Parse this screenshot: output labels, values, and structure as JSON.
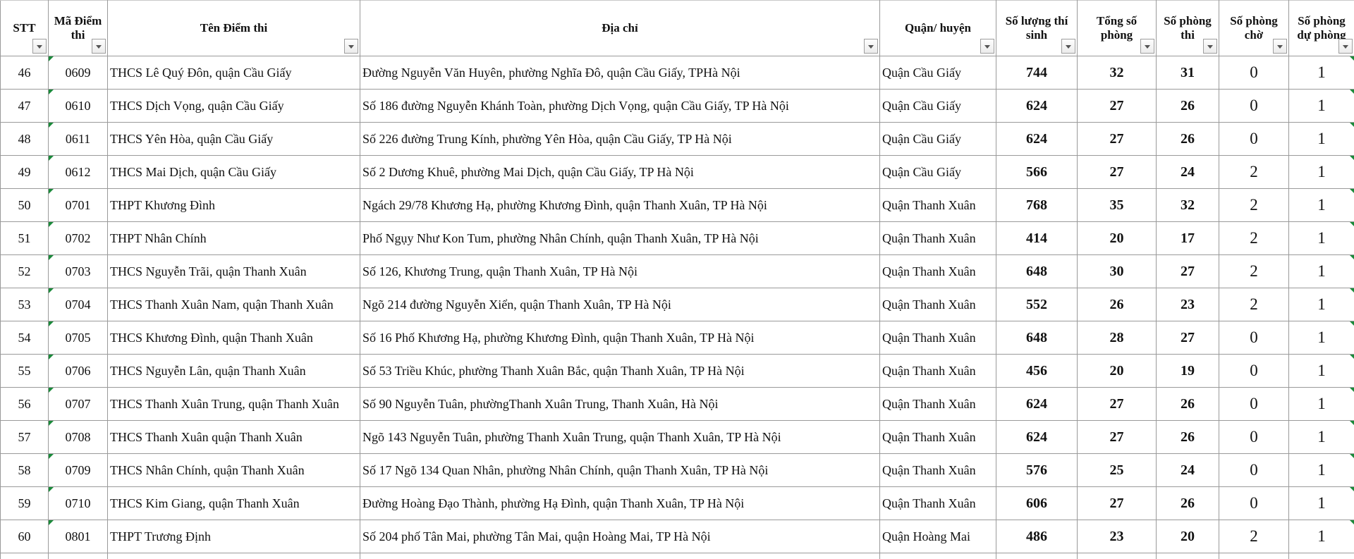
{
  "headers": {
    "stt": "STT",
    "ma_diem_thi": "Mã Điểm thi",
    "ten_diem_thi": "Tên Điểm thi",
    "dia_chi": "Địa chỉ",
    "quan_huyen": "Quận/ huyện",
    "so_luong_thi_sinh": "Số lượng thí sinh",
    "tong_so_phong": "Tổng số phòng",
    "so_phong_thi": "Số phòng thi",
    "so_phong_cho": "Số phòng chờ",
    "so_phong_du_phong": "Số phòng dự phòng"
  },
  "rows": [
    {
      "stt": "46",
      "ma": "0609",
      "ten": "THCS Lê Quý Đôn, quận Cầu Giấy",
      "dia_chi": "Đường Nguyễn Văn Huyên, phường Nghĩa Đô, quận Cầu Giấy, TPHà Nội",
      "quan": "Quận Cầu Giấy",
      "so_luong": "744",
      "tong_phong": "32",
      "phong_thi": "31",
      "phong_cho": "0",
      "du_phong": "1"
    },
    {
      "stt": "47",
      "ma": "0610",
      "ten": "THCS Dịch Vọng, quận Cầu Giấy",
      "dia_chi": "Số 186 đường Nguyễn Khánh Toàn, phường Dịch Vọng, quận Cầu Giấy, TP Hà Nội",
      "quan": "Quận Cầu Giấy",
      "so_luong": "624",
      "tong_phong": "27",
      "phong_thi": "26",
      "phong_cho": "0",
      "du_phong": "1"
    },
    {
      "stt": "48",
      "ma": "0611",
      "ten": "THCS Yên Hòa, quận Cầu Giấy",
      "dia_chi": "Số 226 đường Trung Kính, phường Yên Hòa, quận Cầu Giấy, TP Hà Nội",
      "quan": "Quận Cầu Giấy",
      "so_luong": "624",
      "tong_phong": "27",
      "phong_thi": "26",
      "phong_cho": "0",
      "du_phong": "1"
    },
    {
      "stt": "49",
      "ma": "0612",
      "ten": "THCS Mai Dịch, quận Cầu Giấy",
      "dia_chi": "Số 2 Dương Khuê, phường Mai Dịch, quận Cầu Giấy, TP Hà Nội",
      "quan": "Quận Cầu Giấy",
      "so_luong": "566",
      "tong_phong": "27",
      "phong_thi": "24",
      "phong_cho": "2",
      "du_phong": "1"
    },
    {
      "stt": "50",
      "ma": "0701",
      "ten": "THPT Khương Đình",
      "dia_chi": "Ngách 29/78 Khương Hạ, phường Khương Đình, quận Thanh Xuân, TP Hà Nội",
      "quan": "Quận Thanh Xuân",
      "so_luong": "768",
      "tong_phong": "35",
      "phong_thi": "32",
      "phong_cho": "2",
      "du_phong": "1"
    },
    {
      "stt": "51",
      "ma": "0702",
      "ten": "THPT Nhân Chính",
      "dia_chi": "Phố Ngụy Như Kon Tum, phường Nhân Chính, quận Thanh Xuân, TP Hà Nội",
      "quan": "Quận Thanh Xuân",
      "so_luong": "414",
      "tong_phong": "20",
      "phong_thi": "17",
      "phong_cho": "2",
      "du_phong": "1"
    },
    {
      "stt": "52",
      "ma": "0703",
      "ten": "THCS Nguyễn Trãi, quận Thanh Xuân",
      "dia_chi": "Số 126, Khương Trung, quận Thanh Xuân, TP Hà Nội",
      "quan": "Quận Thanh Xuân",
      "so_luong": "648",
      "tong_phong": "30",
      "phong_thi": "27",
      "phong_cho": "2",
      "du_phong": "1"
    },
    {
      "stt": "53",
      "ma": "0704",
      "ten": "THCS Thanh Xuân Nam, quận Thanh Xuân",
      "dia_chi": "Ngõ 214 đường Nguyễn Xiển, quận Thanh Xuân, TP Hà Nội",
      "quan": "Quận Thanh Xuân",
      "so_luong": "552",
      "tong_phong": "26",
      "phong_thi": "23",
      "phong_cho": "2",
      "du_phong": "1"
    },
    {
      "stt": "54",
      "ma": "0705",
      "ten": "THCS Khương Đình, quận Thanh Xuân",
      "dia_chi": "Số 16 Phố Khương Hạ, phường Khương Đình, quận Thanh Xuân, TP Hà Nội",
      "quan": "Quận Thanh Xuân",
      "so_luong": "648",
      "tong_phong": "28",
      "phong_thi": "27",
      "phong_cho": "0",
      "du_phong": "1"
    },
    {
      "stt": "55",
      "ma": "0706",
      "ten": "THCS Nguyễn Lân, quận Thanh Xuân",
      "dia_chi": "Số 53 Triều Khúc, phường Thanh Xuân Bắc, quận Thanh Xuân, TP Hà Nội",
      "quan": "Quận Thanh Xuân",
      "so_luong": "456",
      "tong_phong": "20",
      "phong_thi": "19",
      "phong_cho": "0",
      "du_phong": "1"
    },
    {
      "stt": "56",
      "ma": "0707",
      "ten": "THCS Thanh Xuân Trung, quận Thanh Xuân",
      "dia_chi": "Số 90 Nguyễn Tuân, phườngThanh Xuân Trung, Thanh Xuân, Hà Nội",
      "quan": "Quận Thanh Xuân",
      "so_luong": "624",
      "tong_phong": "27",
      "phong_thi": "26",
      "phong_cho": "0",
      "du_phong": "1"
    },
    {
      "stt": "57",
      "ma": "0708",
      "ten": "THCS Thanh Xuân quận Thanh Xuân",
      "dia_chi": "Ngõ 143 Nguyễn Tuân, phường Thanh Xuân Trung, quận Thanh Xuân, TP Hà Nội",
      "quan": "Quận Thanh Xuân",
      "so_luong": "624",
      "tong_phong": "27",
      "phong_thi": "26",
      "phong_cho": "0",
      "du_phong": "1"
    },
    {
      "stt": "58",
      "ma": "0709",
      "ten": "THCS Nhân Chính, quận Thanh Xuân",
      "dia_chi": "Số 17 Ngõ 134 Quan Nhân, phường Nhân Chính, quận Thanh Xuân, TP Hà Nội",
      "quan": "Quận Thanh Xuân",
      "so_luong": "576",
      "tong_phong": "25",
      "phong_thi": "24",
      "phong_cho": "0",
      "du_phong": "1"
    },
    {
      "stt": "59",
      "ma": "0710",
      "ten": "THCS Kim Giang, quận Thanh Xuân",
      "dia_chi": "Đường Hoàng Đạo Thành, phường Hạ Đình, quận Thanh Xuân, TP Hà Nội",
      "quan": "Quận Thanh Xuân",
      "so_luong": "606",
      "tong_phong": "27",
      "phong_thi": "26",
      "phong_cho": "0",
      "du_phong": "1"
    },
    {
      "stt": "60",
      "ma": "0801",
      "ten": "THPT Trương Định",
      "dia_chi": "Số 204 phố Tân Mai, phường Tân Mai, quận Hoàng Mai, TP Hà Nội",
      "quan": "Quận Hoàng Mai",
      "so_luong": "486",
      "tong_phong": "23",
      "phong_thi": "20",
      "phong_cho": "2",
      "du_phong": "1"
    }
  ],
  "colors": {
    "grid": "#9a9a9a",
    "error_marker": "#1a8a3a"
  }
}
